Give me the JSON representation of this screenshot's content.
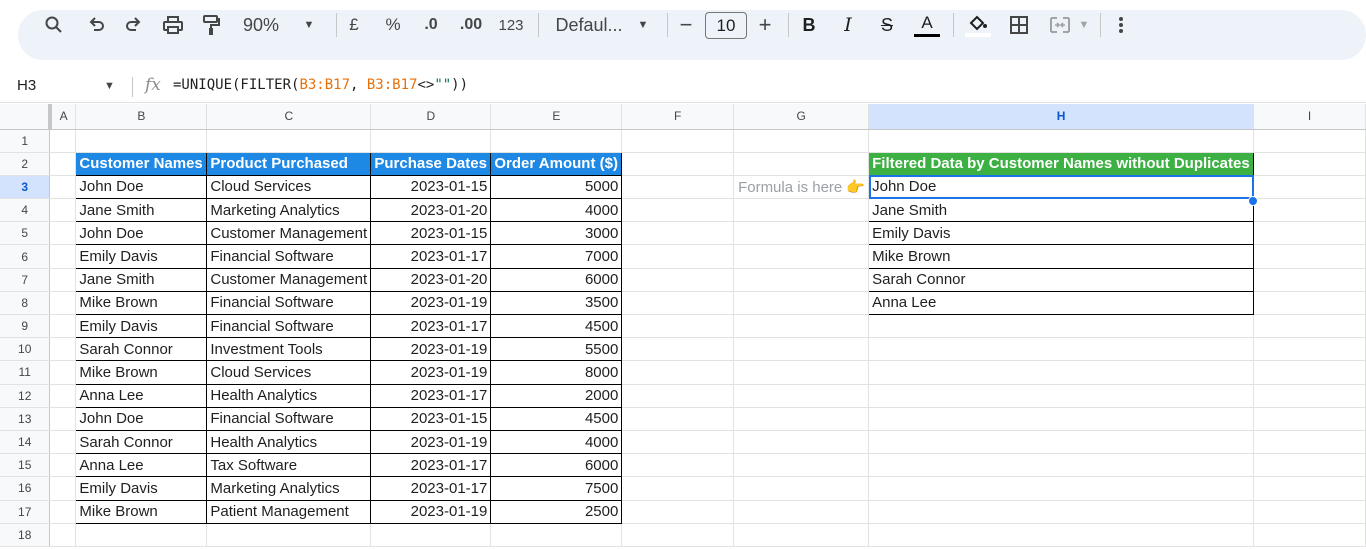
{
  "toolbar": {
    "zoom": "90%",
    "currency": "£",
    "percent": "%",
    "dec_decrease": ".0",
    "dec_increase": ".00",
    "number_format": "123",
    "font": "Defaul...",
    "font_size": "10",
    "minus": "−",
    "plus": "+",
    "bold": "B",
    "italic": "I",
    "strike": "S",
    "text_color": "A",
    "accent_color": "#000000"
  },
  "formula_bar": {
    "cell_ref": "H3",
    "fx": "fx",
    "formula_parts": [
      "=UNIQUE(FILTER(",
      "B3:B17",
      ", ",
      "B3:B17",
      "<>",
      "\"\"",
      "))"
    ]
  },
  "columns": [
    "A",
    "B",
    "C",
    "D",
    "E",
    "F",
    "G",
    "H",
    "I"
  ],
  "row_numbers": [
    "1",
    "2",
    "3",
    "4",
    "5",
    "6",
    "7",
    "8",
    "9",
    "10",
    "11",
    "12",
    "13",
    "14",
    "15",
    "16",
    "17",
    "18"
  ],
  "source_table": {
    "headers": [
      "Customer Names",
      "Product Purchased",
      "Purchase Dates",
      "Order Amount ($)"
    ],
    "rows": [
      [
        "John Doe",
        "Cloud Services",
        "2023-01-15",
        "5000"
      ],
      [
        "Jane Smith",
        "Marketing Analytics",
        "2023-01-20",
        "4000"
      ],
      [
        "John Doe",
        "Customer Management",
        "2023-01-15",
        "3000"
      ],
      [
        "Emily Davis",
        "Financial Software",
        "2023-01-17",
        "7000"
      ],
      [
        "Jane Smith",
        "Customer Management",
        "2023-01-20",
        "6000"
      ],
      [
        "Mike Brown",
        "Financial Software",
        "2023-01-19",
        "3500"
      ],
      [
        "Emily Davis",
        "Financial Software",
        "2023-01-17",
        "4500"
      ],
      [
        "Sarah Connor",
        "Investment Tools",
        "2023-01-19",
        "5500"
      ],
      [
        "Mike Brown",
        "Cloud Services",
        "2023-01-19",
        "8000"
      ],
      [
        "Anna Lee",
        "Health Analytics",
        "2023-01-17",
        "2000"
      ],
      [
        "John Doe",
        "Financial Software",
        "2023-01-15",
        "4500"
      ],
      [
        "Sarah Connor",
        "Health Analytics",
        "2023-01-19",
        "4000"
      ],
      [
        "Anna Lee",
        "Tax Software",
        "2023-01-17",
        "6000"
      ],
      [
        "Emily Davis",
        "Marketing Analytics",
        "2023-01-17",
        "7500"
      ],
      [
        "Mike Brown",
        "Patient Management",
        "2023-01-19",
        "2500"
      ]
    ]
  },
  "note": "Formula is here 👉",
  "result_table": {
    "header": "Filtered Data by Customer Names without Duplicates",
    "rows": [
      "John Doe",
      "Jane Smith",
      "Emily Davis",
      "Mike Brown",
      "Sarah Connor",
      "Anna Lee"
    ]
  },
  "colors": {
    "header_blue": "#1e88e5",
    "header_green": "#3cb043",
    "selection": "#1a73e8"
  }
}
